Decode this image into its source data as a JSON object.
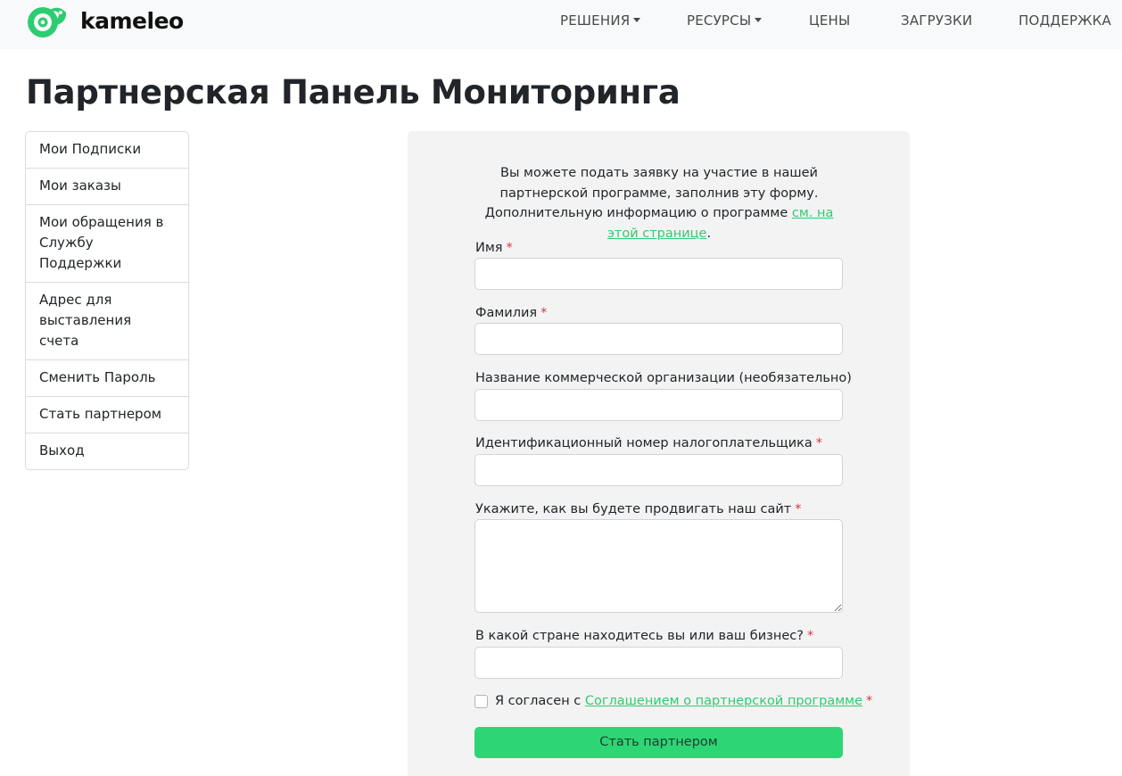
{
  "brand": {
    "name": "kameleo",
    "accent": "#2ecc71"
  },
  "nav": {
    "items": [
      {
        "label": "РЕШЕНИЯ",
        "dropdown": true
      },
      {
        "label": "РЕСУРСЫ",
        "dropdown": true
      },
      {
        "label": "ЦЕНЫ",
        "dropdown": false
      },
      {
        "label": "ЗАГРУЗКИ",
        "dropdown": false
      },
      {
        "label": "ПОДДЕРЖКА",
        "dropdown": false
      }
    ]
  },
  "page": {
    "title": "Партнерская Панель Мониторинга"
  },
  "sidebar": {
    "items": [
      {
        "label": "Мои Подписки"
      },
      {
        "label": "Мои заказы"
      },
      {
        "label": "Мои обращения в Службу Поддержки"
      },
      {
        "label": "Адрес для выставления счета"
      },
      {
        "label": "Сменить Пароль"
      },
      {
        "label": "Стать партнером"
      },
      {
        "label": "Выход"
      }
    ]
  },
  "form": {
    "intro_text": "Вы можете подать заявку на участие в нашей партнерской программе, заполнив эту форму. Дополнительную информацию о программе ",
    "intro_link": "см. на этой странице",
    "intro_end": ".",
    "required_mark": "*",
    "fields": [
      {
        "label": "Имя",
        "required": true,
        "value": ""
      },
      {
        "label": "Фамилия",
        "required": true,
        "value": ""
      },
      {
        "label": "Название коммерческой организации (необязательно)",
        "required": false,
        "value": ""
      },
      {
        "label": "Идентификационный номер налогоплательщика",
        "required": true,
        "value": ""
      },
      {
        "label": "Укажите, как вы будете продвигать наш сайт",
        "required": true,
        "value": ""
      },
      {
        "label": "В какой стране находитесь вы или ваш бизнес?",
        "required": true,
        "value": ""
      }
    ],
    "agree_prefix": "Я согласен с ",
    "agree_link": "Соглашением о партнерской программе",
    "agree_checked": false,
    "submit_label": "Стать партнером"
  }
}
